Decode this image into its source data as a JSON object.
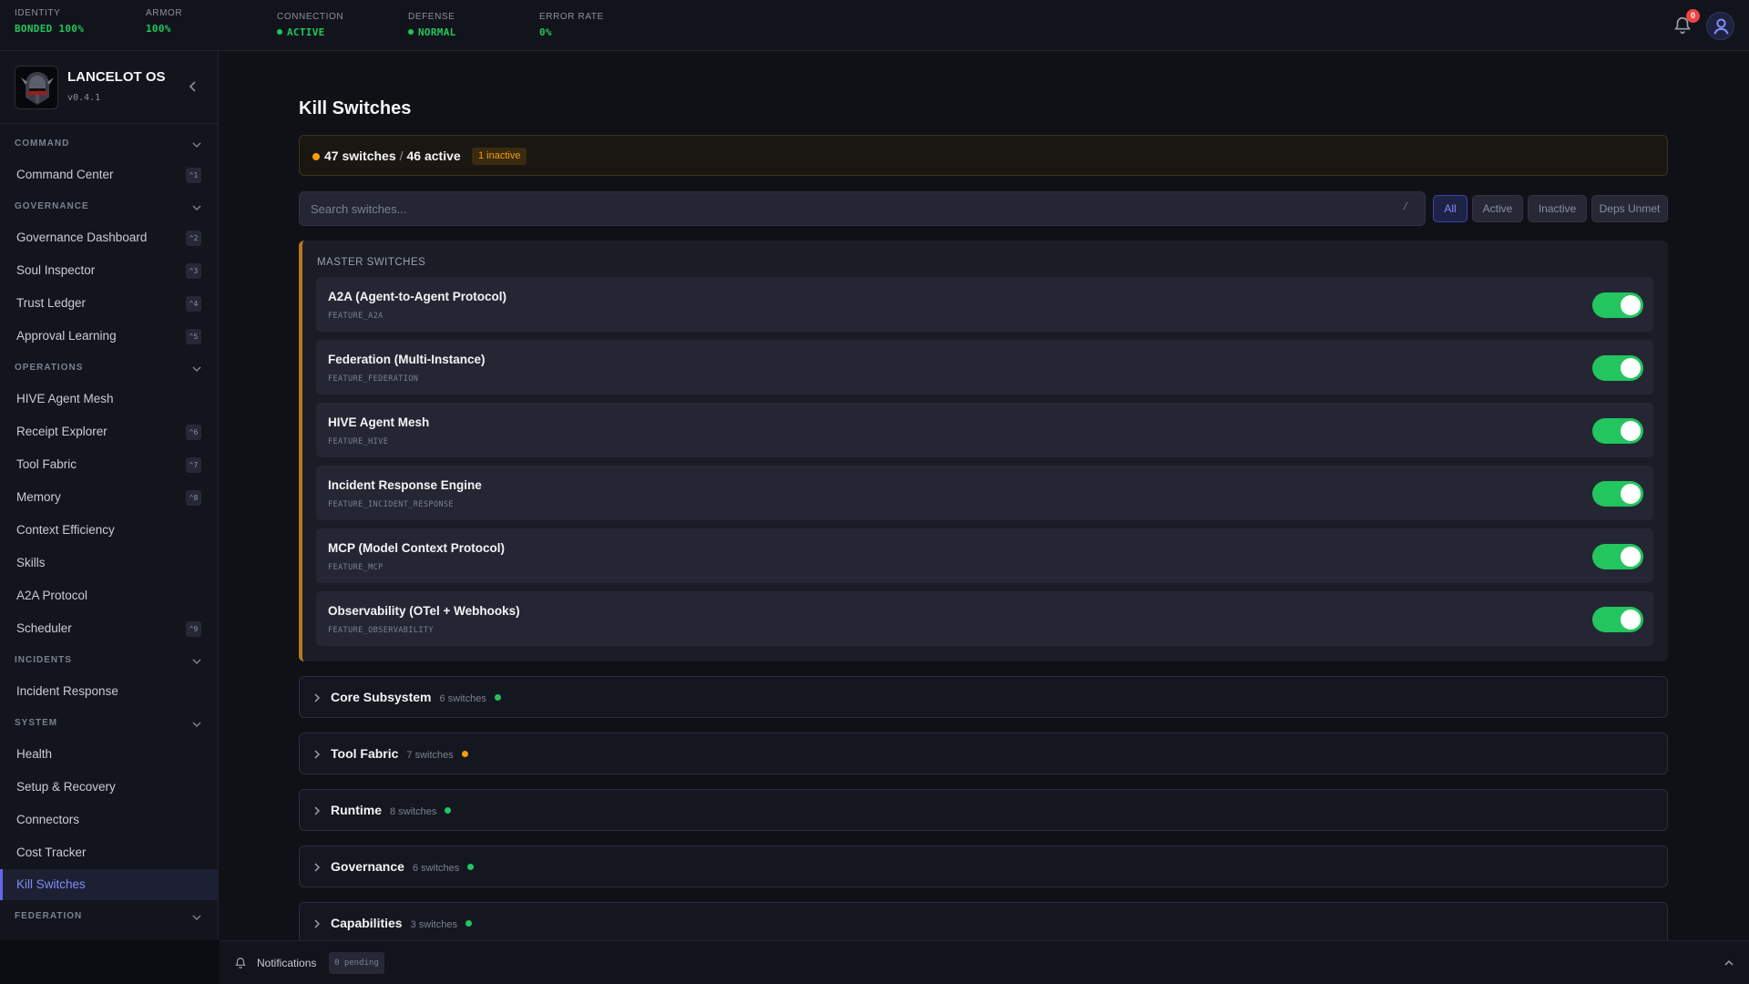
{
  "topbar": {
    "metrics": [
      {
        "label": "IDENTITY",
        "value": "BONDED 100%",
        "progress": 1.0
      },
      {
        "label": "ARMOR",
        "value": "100%",
        "progress": 1.0
      },
      {
        "label": "CONNECTION",
        "value": "ACTIVE"
      },
      {
        "label": "DEFENSE",
        "value": "NORMAL"
      },
      {
        "label": "ERROR RATE",
        "value": "0%"
      }
    ],
    "notification_count": "0"
  },
  "sidebar": {
    "brand_name": "LANCELOT OS",
    "version": "v0.4.1",
    "sections": {
      "command": "COMMAND",
      "governance": "GOVERNANCE",
      "operations": "OPERATIONS",
      "incidents": "INCIDENTS",
      "system": "SYSTEM",
      "federation": "FEDERATION"
    },
    "items": {
      "command_center": {
        "label": "Command Center",
        "key": "^1"
      },
      "governance_dashboard": {
        "label": "Governance Dashboard",
        "key": "^2"
      },
      "soul_inspector": {
        "label": "Soul Inspector",
        "key": "^3"
      },
      "trust_ledger": {
        "label": "Trust Ledger",
        "key": "^4"
      },
      "approval_learning": {
        "label": "Approval Learning",
        "key": "^5"
      },
      "hive_agent_mesh": {
        "label": "HIVE Agent Mesh"
      },
      "receipt_explorer": {
        "label": "Receipt Explorer",
        "key": "^6"
      },
      "tool_fabric": {
        "label": "Tool Fabric",
        "key": "^7"
      },
      "memory": {
        "label": "Memory",
        "key": "^8"
      },
      "context_efficiency": {
        "label": "Context Efficiency"
      },
      "skills": {
        "label": "Skills"
      },
      "a2a_protocol": {
        "label": "A2A Protocol"
      },
      "scheduler": {
        "label": "Scheduler",
        "key": "^9"
      },
      "incident_response": {
        "label": "Incident Response"
      },
      "health": {
        "label": "Health"
      },
      "setup_recovery": {
        "label": "Setup & Recovery"
      },
      "connectors": {
        "label": "Connectors"
      },
      "cost_tracker": {
        "label": "Cost Tracker"
      },
      "kill_switches": {
        "label": "Kill Switches"
      }
    }
  },
  "main": {
    "title": "Kill Switches",
    "summary": {
      "switches": "47 switches",
      "separator": "/",
      "active": "46 active",
      "inactive_badge": "1 inactive"
    },
    "search": {
      "placeholder": "Search switches...",
      "shortcut": "/"
    },
    "filters": {
      "all": "All",
      "active": "Active",
      "inactive": "Inactive",
      "deps_unmet": "Deps Unmet"
    },
    "master": {
      "title": "MASTER SWITCHES",
      "switches": [
        {
          "name": "A2A (Agent-to-Agent Protocol)",
          "code": "FEATURE_A2A",
          "enabled": true
        },
        {
          "name": "Federation (Multi-Instance)",
          "code": "FEATURE_FEDERATION",
          "enabled": true
        },
        {
          "name": "HIVE Agent Mesh",
          "code": "FEATURE_HIVE",
          "enabled": true
        },
        {
          "name": "Incident Response Engine",
          "code": "FEATURE_INCIDENT_RESPONSE",
          "enabled": true
        },
        {
          "name": "MCP (Model Context Protocol)",
          "code": "FEATURE_MCP",
          "enabled": true
        },
        {
          "name": "Observability (OTel + Webhooks)",
          "code": "FEATURE_OBSERVABILITY",
          "enabled": true
        }
      ]
    },
    "groups": [
      {
        "name": "Core Subsystem",
        "count": "6 switches",
        "status_color": "#22c55e"
      },
      {
        "name": "Tool Fabric",
        "count": "7 switches",
        "status_color": "#f59e0b"
      },
      {
        "name": "Runtime",
        "count": "8 switches",
        "status_color": "#22c55e"
      },
      {
        "name": "Governance",
        "count": "6 switches",
        "status_color": "#22c55e"
      },
      {
        "name": "Capabilities",
        "count": "3 switches",
        "status_color": "#22c55e"
      }
    ]
  },
  "notifications": {
    "label": "Notifications",
    "pending": "0 pending"
  },
  "colors": {
    "accent": "#6366f1",
    "success": "#22c55e",
    "warning": "#f59e0b",
    "danger": "#ef4444"
  }
}
